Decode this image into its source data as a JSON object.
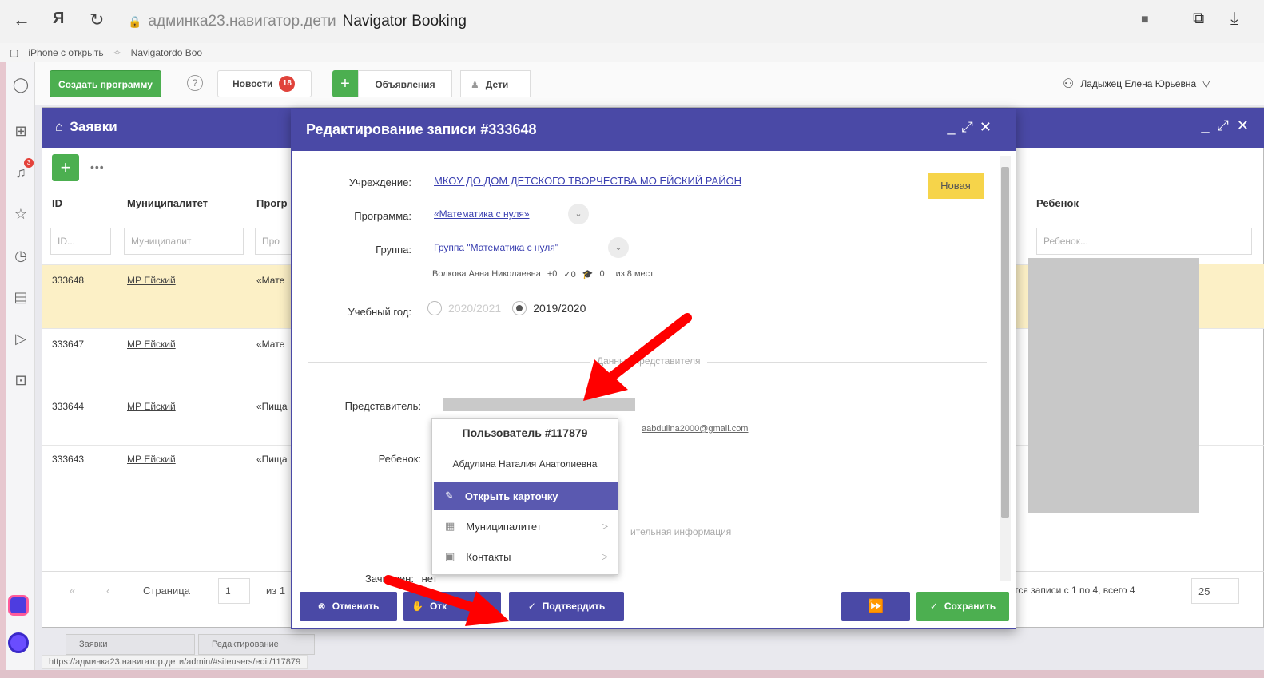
{
  "browser": {
    "host": "админка23.навигатор.дети",
    "tab_title": "Navigator Booking",
    "bookmarks": [
      "iPhone с открыть",
      "Navigatordo Boo"
    ],
    "status_url": "https://админка23.навигатор.дети/admin/#siteusers/edit/117879"
  },
  "toolbar": {
    "create_label": "Создать программу",
    "news_label": "Новости",
    "news_badge": "18",
    "ads_label": "Объявления",
    "kids_label": "Дети",
    "user_name": "Ладыжец Елена Юрьевна"
  },
  "sidebar": {
    "bell_badge": "3"
  },
  "list_window": {
    "title": "Заявки",
    "more_label": "•••",
    "columns": [
      "ID",
      "Муниципалитет",
      "Прогр",
      "Ребенок"
    ],
    "filters": [
      "ID...",
      "Муниципалит",
      "Про",
      "Ребенок..."
    ],
    "rows": [
      {
        "id": "333648",
        "mun": "МР Ейский",
        "prog": "«Мате"
      },
      {
        "id": "333647",
        "mun": "МР Ейский",
        "prog": "«Мате"
      },
      {
        "id": "333644",
        "mun": "МР Ейский",
        "prog": "«Пища"
      },
      {
        "id": "333643",
        "mun": "МР Ейский",
        "prog": "«Пища"
      }
    ],
    "pager": {
      "page_label": "Страница",
      "page_value": "1",
      "of_label": "из 1",
      "records_info": "тся записи с 1 по 4, всего 4",
      "page_size": "25"
    },
    "tabs": [
      "Заявки",
      "Редактирование"
    ]
  },
  "modal": {
    "title": "Редактирование записи #333648",
    "status": "Новая",
    "labels": {
      "institution": "Учреждение:",
      "program": "Программа:",
      "group": "Группа:",
      "year": "Учебный год:",
      "representative": "Представитель:",
      "child": "Ребенок:",
      "enrolled": "Зачислен:"
    },
    "institution": "МКОУ ДО ДОМ ДЕТСКОГО ТВОРЧЕСТВА МО ЕЙСКИЙ РАЙОН",
    "program": "«Математика с нуля»",
    "group": "Группа \"Математика с нуля\"",
    "group_info": {
      "teacher": "Волкова Анна Николаевна",
      "plus": "+0",
      "check": "✓0",
      "cap": "0",
      "places": "из 8 мест"
    },
    "years": [
      "2020/2021",
      "2019/2020"
    ],
    "section_rep": "Данные представителя",
    "section_extra": "ительная информация",
    "email": "aabdulina2000@gmail.com",
    "enrolled_value": "нет",
    "buttons": {
      "cancel": "Отменить",
      "reject": "Отк",
      "confirm": "Подтвердить",
      "save": "Сохранить"
    }
  },
  "popup": {
    "title": "Пользователь #117879",
    "name": "Абдулина Наталия Анатолиевна",
    "items": [
      "Открыть карточку",
      "Муниципалитет",
      "Контакты"
    ]
  },
  "colors": {
    "header": "#4a49a6",
    "green": "#4caf50",
    "selected_row": "#fcf0c6",
    "status_new": "#f6d44a",
    "annotation_arrow": "#ff0000"
  }
}
